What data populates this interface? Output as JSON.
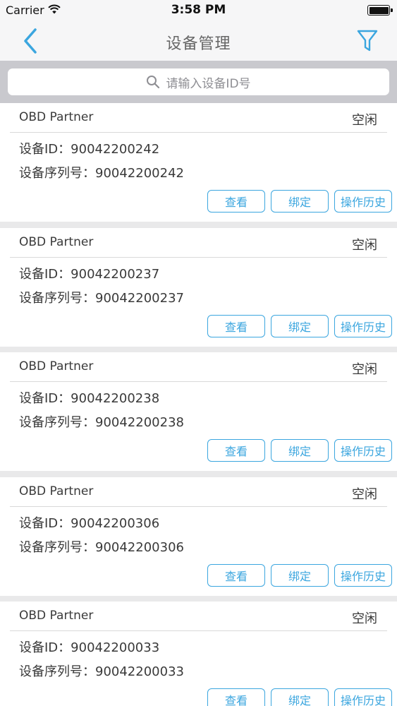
{
  "status_bar": {
    "carrier": "Carrier",
    "time": "3:58 PM",
    "battery_level_percent": 100
  },
  "nav": {
    "title": "设备管理",
    "back_icon": "chevron-left-icon",
    "filter_icon": "filter-funnel-icon",
    "accent_color": "#3ba6df"
  },
  "search": {
    "placeholder": "请输入设备ID号",
    "value": ""
  },
  "devices": [
    {
      "name": "OBD Partner",
      "status": "空闲",
      "id_line": "设备ID：90042200242",
      "serial_line": "设备序列号：90042200242",
      "view_label": "查看",
      "bind_label": "绑定",
      "history_label": "操作历史"
    },
    {
      "name": "OBD Partner",
      "status": "空闲",
      "id_line": "设备ID：90042200237",
      "serial_line": "设备序列号：90042200237",
      "view_label": "查看",
      "bind_label": "绑定",
      "history_label": "操作历史"
    },
    {
      "name": "OBD Partner",
      "status": "空闲",
      "id_line": "设备ID：90042200238",
      "serial_line": "设备序列号：90042200238",
      "view_label": "查看",
      "bind_label": "绑定",
      "history_label": "操作历史"
    },
    {
      "name": "OBD Partner",
      "status": "空闲",
      "id_line": "设备ID：90042200306",
      "serial_line": "设备序列号：90042200306",
      "view_label": "查看",
      "bind_label": "绑定",
      "history_label": "操作历史"
    },
    {
      "name": "OBD Partner",
      "status": "空闲",
      "id_line": "设备ID：90042200033",
      "serial_line": "设备序列号：90042200033",
      "view_label": "查看",
      "bind_label": "绑定",
      "history_label": "操作历史"
    }
  ]
}
